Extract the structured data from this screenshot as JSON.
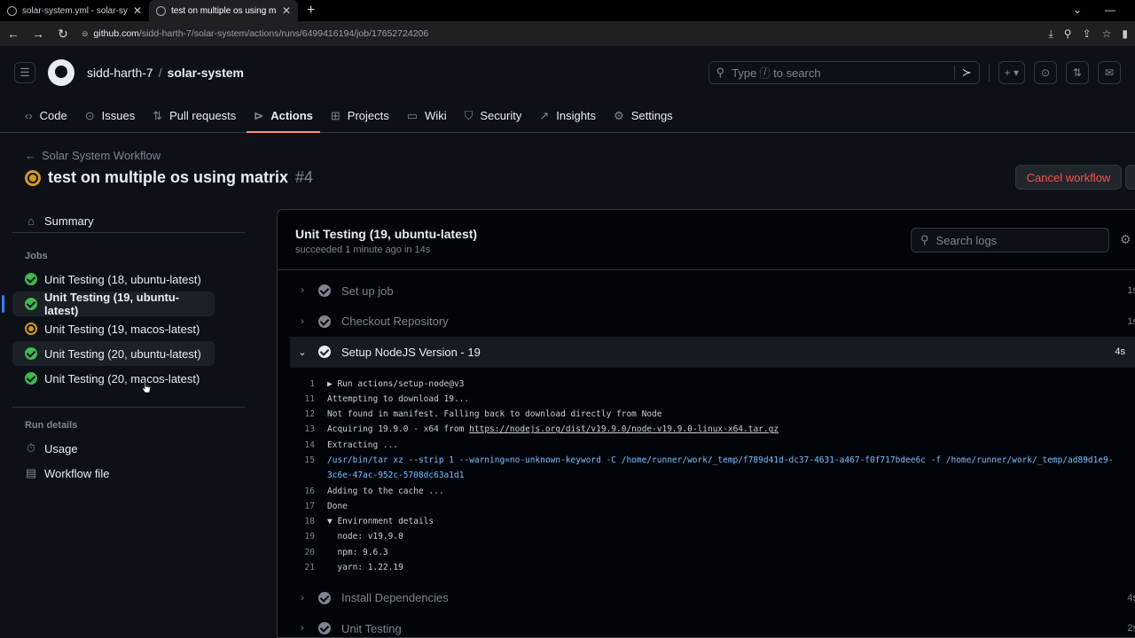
{
  "browser": {
    "tabs": [
      {
        "label": "solar-system.yml - solar-system"
      },
      {
        "label": "test on multiple os using matrix"
      }
    ],
    "url_host": "github.com",
    "url_path": "/sidd-harth-7/solar-system/actions/runs/6499416194/job/17652724206"
  },
  "header": {
    "owner": "sidd-harth-7",
    "separator": "/",
    "repo": "solar-system",
    "search_placeholder_pre": "Type",
    "search_key": "/",
    "search_placeholder_post": "to search"
  },
  "repo_nav": [
    {
      "label": "Code",
      "icon": "code-icon"
    },
    {
      "label": "Issues",
      "icon": "issue-icon"
    },
    {
      "label": "Pull requests",
      "icon": "pull-request-icon"
    },
    {
      "label": "Actions",
      "icon": "play-icon"
    },
    {
      "label": "Projects",
      "icon": "table-icon"
    },
    {
      "label": "Wiki",
      "icon": "book-icon"
    },
    {
      "label": "Security",
      "icon": "shield-icon"
    },
    {
      "label": "Insights",
      "icon": "graph-icon"
    },
    {
      "label": "Settings",
      "icon": "gear-icon"
    }
  ],
  "run": {
    "back_label": "Solar System Workflow",
    "title": "test on multiple os using matrix",
    "number": "#4",
    "cancel_label": "Cancel workflow"
  },
  "sidebar": {
    "summary": "Summary",
    "jobs_heading": "Jobs",
    "jobs": [
      {
        "label": "Unit Testing (18, ubuntu-latest)",
        "status": "success"
      },
      {
        "label": "Unit Testing (19, ubuntu-latest)",
        "status": "success"
      },
      {
        "label": "Unit Testing (19, macos-latest)",
        "status": "in_progress"
      },
      {
        "label": "Unit Testing (20, ubuntu-latest)",
        "status": "success"
      },
      {
        "label": "Unit Testing (20, macos-latest)",
        "status": "success"
      }
    ],
    "run_details_heading": "Run details",
    "usage": "Usage",
    "workflow_file": "Workflow file"
  },
  "job": {
    "title": "Unit Testing (19, ubuntu-latest)",
    "subtitle": "succeeded 1 minute ago in 14s",
    "search_placeholder": "Search logs",
    "steps_before": [
      {
        "label": "Set up job",
        "duration": "1s"
      },
      {
        "label": "Checkout Repository",
        "duration": "1s"
      }
    ],
    "open_step": {
      "label": "Setup NodeJS Version - 19",
      "duration": "4s"
    },
    "log": [
      {
        "n": "1",
        "text": "▶ Run actions/setup-node@v3"
      },
      {
        "n": "11",
        "text": "Attempting to download 19..."
      },
      {
        "n": "12",
        "text": "Not found in manifest. Falling back to download directly from Node"
      },
      {
        "n": "13",
        "text": "Acquiring 19.9.0 - x64 from ",
        "link": "https://nodejs.org/dist/v19.9.0/node-v19.9.0-linux-x64.tar.gz"
      },
      {
        "n": "14",
        "text": "Extracting ..."
      },
      {
        "n": "15",
        "text": "/usr/bin/tar xz --strip 1 --warning=no-unknown-keyword -C /home/runner/work/_temp/f789d41d-dc37-4631-a467-f0f717bdee6c -f /home/runner/work/_temp/ad89d1e9-3c6e-47ac-952c-5708dc63a1d1"
      },
      {
        "n": "16",
        "text": "Adding to the cache ..."
      },
      {
        "n": "17",
        "text": "Done"
      },
      {
        "n": "18",
        "text": "▼ Environment details"
      },
      {
        "n": "19",
        "text": "  node: v19.9.0"
      },
      {
        "n": "20",
        "text": "  npm: 9.6.3"
      },
      {
        "n": "21",
        "text": "  yarn: 1.22.19"
      }
    ],
    "steps_after": [
      {
        "label": "Install Dependencies",
        "duration": "4s"
      },
      {
        "label": "Unit Testing",
        "duration": "2s"
      }
    ]
  },
  "colors": {
    "success": "#3fb950",
    "pending": "#d29922",
    "danger": "#f85149",
    "accent_underline": "#fd8c73"
  }
}
